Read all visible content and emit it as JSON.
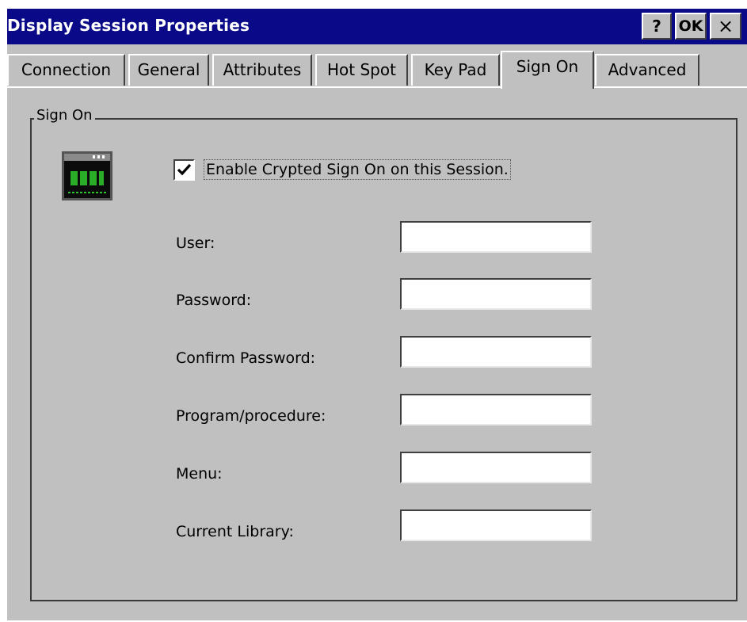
{
  "window": {
    "title": "Display Session Properties",
    "buttons": {
      "help_label": "?",
      "ok_label": "OK",
      "close_label": "×"
    }
  },
  "tabs": [
    {
      "label": "Connection"
    },
    {
      "label": "General"
    },
    {
      "label": "Attributes"
    },
    {
      "label": "Hot Spot"
    },
    {
      "label": "Key Pad"
    },
    {
      "label": "Sign On",
      "active": true
    },
    {
      "label": "Advanced"
    }
  ],
  "sign_on": {
    "group_label": "Sign On",
    "enable_checkbox": {
      "label": "Enable Crypted Sign On on this Session.",
      "checked": true
    },
    "fields": [
      {
        "label": "User:",
        "value": ""
      },
      {
        "label": "Password:",
        "value": ""
      },
      {
        "label": "Confirm Password:",
        "value": ""
      },
      {
        "label": "Program/procedure:",
        "value": ""
      },
      {
        "label": "Menu:",
        "value": ""
      },
      {
        "label": "Current Library:",
        "value": ""
      }
    ]
  },
  "colors": {
    "titlebar": "#0a0a88",
    "face": "#c0c0c0",
    "icon_text": "#2ec02e"
  }
}
